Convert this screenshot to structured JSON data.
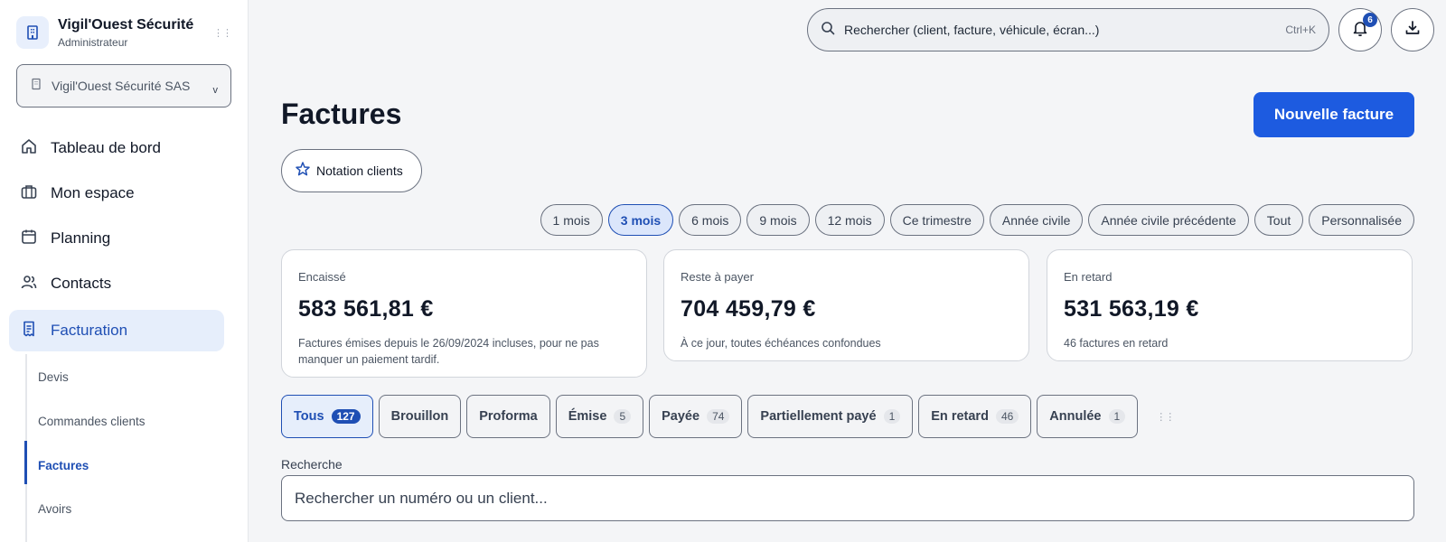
{
  "brand": {
    "name": "Vigil'Ouest Sécurité",
    "role": "Administrateur"
  },
  "org_select": {
    "value": "Vigil'Ouest Sécurité SAS",
    "chevron": "v"
  },
  "nav": [
    {
      "label": "Tableau de bord",
      "icon": "home-icon"
    },
    {
      "label": "Mon espace",
      "icon": "briefcase-icon"
    },
    {
      "label": "Planning",
      "icon": "calendar-icon"
    },
    {
      "label": "Contacts",
      "icon": "users-icon"
    },
    {
      "label": "Facturation",
      "icon": "receipt-icon",
      "active": true
    }
  ],
  "subnav": [
    {
      "label": "Devis"
    },
    {
      "label": "Commandes clients"
    },
    {
      "label": "Factures",
      "active": true
    },
    {
      "label": "Avoirs"
    }
  ],
  "topbar": {
    "search_placeholder": "Rechercher (client, facture, véhicule, écran...)",
    "shortcut": "Ctrl+K",
    "notif_count": "6"
  },
  "page": {
    "title": "Factures",
    "new_button": "Nouvelle facture",
    "notation_button": "Notation clients"
  },
  "periods": [
    "1 mois",
    "3 mois",
    "6 mois",
    "9 mois",
    "12 mois",
    "Ce trimestre",
    "Année civile",
    "Année civile précédente",
    "Tout",
    "Personnalisée"
  ],
  "active_period": "3 mois",
  "cards": [
    {
      "label": "Encaissé",
      "amount": "583 561,81 €",
      "note": "Factures émises depuis le 26/09/2024 incluses, pour ne pas manquer un paiement tardif."
    },
    {
      "label": "Reste à payer",
      "amount": "704 459,79 €",
      "note": "À ce jour, toutes échéances confondues"
    },
    {
      "label": "En retard",
      "amount": "531 563,19 €",
      "note": "46 factures en retard"
    }
  ],
  "statuses": [
    {
      "label": "Tous",
      "count": "127",
      "active": true
    },
    {
      "label": "Brouillon",
      "count": ""
    },
    {
      "label": "Proforma",
      "count": ""
    },
    {
      "label": "Émise",
      "count": "5"
    },
    {
      "label": "Payée",
      "count": "74"
    },
    {
      "label": "Partiellement payé",
      "count": "1"
    },
    {
      "label": "En retard",
      "count": "46"
    },
    {
      "label": "Annulée",
      "count": "1"
    }
  ],
  "search": {
    "label": "Recherche",
    "placeholder": "Rechercher un numéro ou un client..."
  },
  "colors": {
    "accent": "#1d5be0",
    "active_bg": "#e6eefb",
    "active_text": "#1f4fb4"
  }
}
